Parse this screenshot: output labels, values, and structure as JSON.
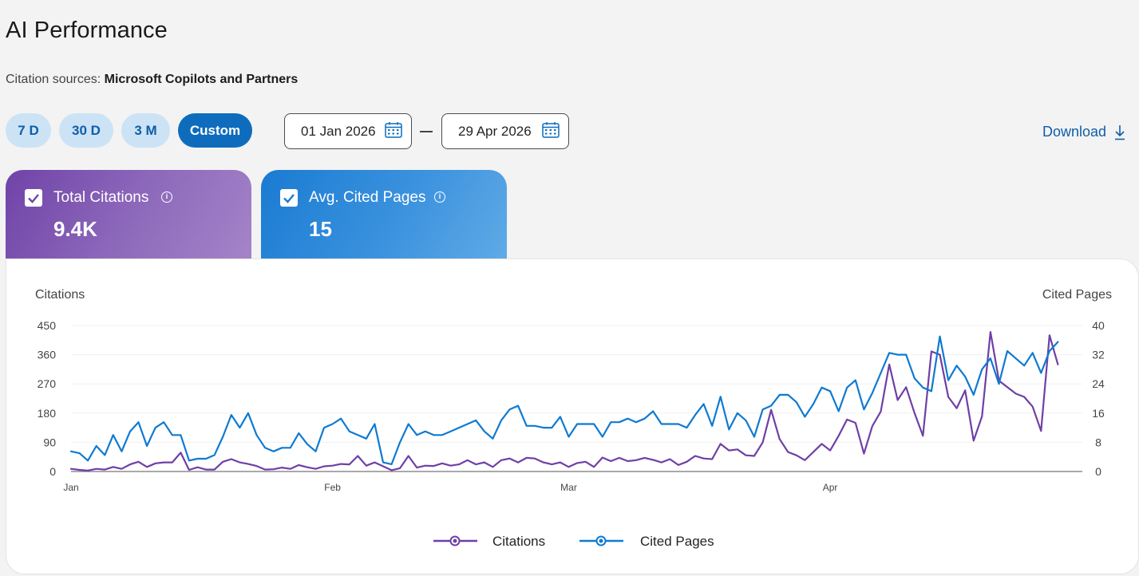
{
  "header": {
    "title": "AI Performance",
    "sources_label": "Citation sources: ",
    "sources_value": "Microsoft Copilots and Partners"
  },
  "range_buttons": [
    {
      "label": "7 D",
      "active": false
    },
    {
      "label": "30 D",
      "active": false
    },
    {
      "label": "3 M",
      "active": false
    },
    {
      "label": "Custom",
      "active": true
    }
  ],
  "date_range": {
    "start": "01 Jan 2026",
    "end": "29 Apr 2026"
  },
  "download_label": "Download",
  "metrics": [
    {
      "label": "Total Citations",
      "value": "9.4K",
      "checked": true,
      "color": "#7a4bad"
    },
    {
      "label": "Avg. Cited Pages",
      "value": "15",
      "checked": true,
      "color": "#1f7fd3"
    }
  ],
  "colors": {
    "accent": "#0f6cbd",
    "citations": "#6f3fa6",
    "cited_pages": "#0f7ad1"
  },
  "chart_data": {
    "type": "line",
    "ylabel_left": "Citations",
    "ylabel_right": "Cited Pages",
    "y_left_ticks": [
      "0",
      "90",
      "180",
      "270",
      "360",
      "450"
    ],
    "y_right_ticks": [
      "0",
      "8",
      "16",
      "24",
      "32",
      "40"
    ],
    "ylim_left": [
      0,
      450
    ],
    "ylim_right": [
      0,
      40
    ],
    "x_ticks": [
      {
        "label": "Jan",
        "day": 1
      },
      {
        "label": "Feb",
        "day": 32
      },
      {
        "label": "Mar",
        "day": 60
      },
      {
        "label": "Apr",
        "day": 91
      }
    ],
    "x_range_days": [
      1,
      119
    ],
    "grid": true,
    "legend_position": "bottom-center",
    "series": [
      {
        "name": "Citations",
        "axis": "left",
        "color": "#6f3fa6",
        "values": [
          8,
          5,
          3,
          8,
          6,
          14,
          8,
          22,
          30,
          14,
          25,
          28,
          28,
          58,
          5,
          13,
          6,
          6,
          30,
          38,
          28,
          23,
          17,
          6,
          7,
          12,
          8,
          20,
          13,
          8,
          16,
          18,
          23,
          22,
          48,
          18,
          28,
          16,
          4,
          10,
          48,
          12,
          18,
          17,
          25,
          18,
          22,
          35,
          22,
          28,
          14,
          35,
          40,
          28,
          42,
          40,
          28,
          22,
          28,
          14,
          26,
          30,
          14,
          43,
          32,
          42,
          32,
          35,
          42,
          36,
          28,
          38,
          20,
          30,
          48,
          40,
          38,
          85,
          65,
          68,
          50,
          48,
          90,
          190,
          100,
          60,
          50,
          35,
          60,
          85,
          65,
          110,
          160,
          150,
          55,
          140,
          185,
          330,
          220,
          260,
          180,
          110,
          370,
          360,
          230,
          195,
          250,
          95,
          170,
          430,
          280,
          260,
          240,
          230,
          200,
          125,
          420,
          330
        ]
      },
      {
        "name": "Cited Pages",
        "axis": "right",
        "color": "#0f7ad1",
        "values": [
          5.5,
          5,
          3,
          7,
          4.5,
          10,
          5.5,
          11,
          13.5,
          7,
          12,
          13.5,
          10,
          10,
          3,
          3.5,
          3.5,
          4.5,
          9.5,
          15.5,
          12,
          16,
          10,
          6.5,
          5.5,
          6.5,
          6.5,
          10.5,
          7.5,
          5.5,
          12,
          13,
          14.5,
          11,
          10,
          9,
          13,
          2.5,
          2,
          8,
          13,
          10,
          11,
          10,
          10,
          11,
          12,
          13,
          14,
          11,
          9,
          14,
          17,
          18,
          12.5,
          12.5,
          12,
          12,
          15,
          9.5,
          13,
          13,
          13,
          9.5,
          13.5,
          13.5,
          14.5,
          13.5,
          14.5,
          16.5,
          13,
          13,
          13,
          12,
          15.5,
          18.5,
          12.5,
          20.5,
          11.5,
          16,
          14,
          9.5,
          17,
          18,
          21,
          21,
          19,
          15,
          18.5,
          23,
          22,
          16.5,
          23,
          25,
          17,
          21.5,
          27,
          32.5,
          32,
          32,
          25.5,
          23,
          22,
          37,
          25,
          29,
          26,
          21,
          28,
          31,
          24,
          33,
          31,
          29,
          32.5,
          27,
          33,
          35.5
        ]
      }
    ]
  }
}
